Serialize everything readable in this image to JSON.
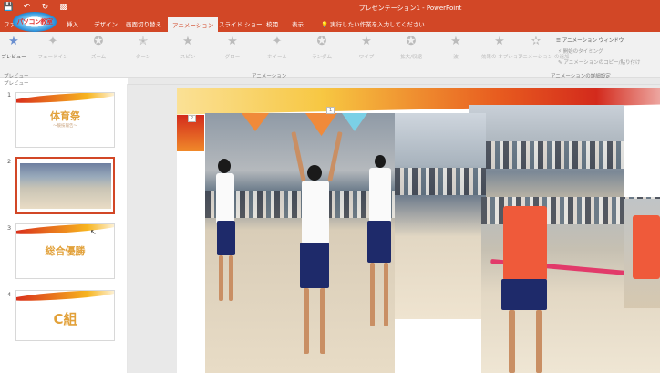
{
  "titlebar": {
    "doc_title": "プレゼンテーション1 - PowerPoint",
    "qat": [
      "save-icon",
      "undo-icon",
      "redo-icon",
      "present-icon"
    ]
  },
  "logo": {
    "text": "パソコン教室"
  },
  "tabs": {
    "items": [
      "ファ",
      "挿入",
      "デザイン",
      "画面切り替え",
      "アニメーション",
      "スライド ショー",
      "校閲",
      "表示"
    ],
    "active": "アニメーション",
    "tellme": "実行したい作業を入力してください..."
  },
  "ribbon": {
    "preview_label": "プレビュー",
    "effects": [
      "フェードイン",
      "ズーム",
      "ターン",
      "スピン",
      "グロー",
      "ホイール",
      "ランダム",
      "ワイプ",
      "拡大/収縮",
      "波"
    ],
    "effect_options_label": "効果の オプション",
    "add_animation_label": "アニメーション の追加",
    "animation_pane": "アニメーション ウィンドウ",
    "trigger": "開始のタイミング",
    "painter": "アニメーションのコピー/貼り付け",
    "groups": {
      "preview": "プレビュー",
      "animation": "アニメーション",
      "advanced": "アニメーションの詳細設定"
    }
  },
  "slides": [
    {
      "num": "1",
      "title": "体育祭",
      "subtitle": "〜競技報告〜"
    },
    {
      "num": "2",
      "title": ""
    },
    {
      "num": "3",
      "title": "総合優勝"
    },
    {
      "num": "4",
      "title": "C組"
    }
  ],
  "slide_area": {
    "badge_1": "2",
    "badge_2": "1"
  },
  "colors": {
    "accent": "#d24726",
    "ribbon": "#f1f1f1"
  }
}
